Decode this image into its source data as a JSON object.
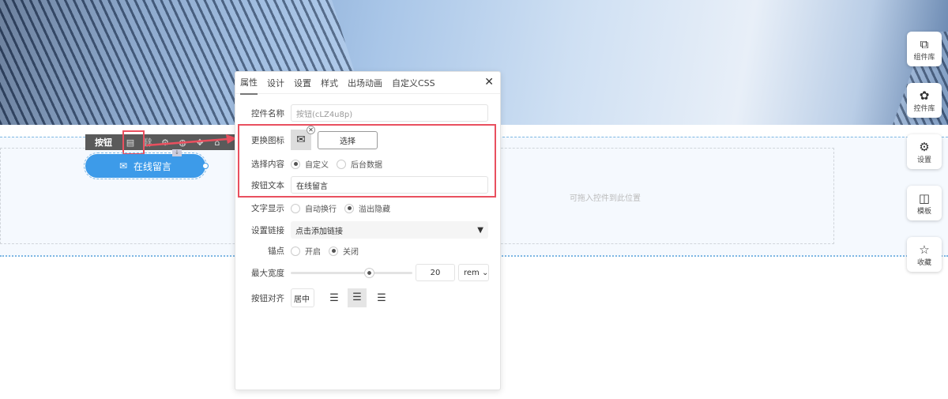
{
  "canvas": {
    "drop_hint": "可拖入控件到此位置"
  },
  "toolbar": {
    "label": "按钮",
    "icons": [
      "edit-icon",
      "link-icon",
      "gear-icon",
      "palette-icon",
      "move-icon",
      "delete-icon"
    ]
  },
  "button": {
    "label": "在线留言",
    "icon": "mail-icon"
  },
  "panel": {
    "tabs": [
      "属性",
      "设计",
      "设置",
      "样式",
      "出场动画",
      "自定义CSS"
    ],
    "name_label": "控件名称",
    "name_value": "按钮(cLZ4u8p)",
    "icon_label": "更换图标",
    "icon_select": "选择",
    "content_label": "选择内容",
    "content_options": [
      "自定义",
      "后台数据"
    ],
    "text_label": "按钮文本",
    "text_value": "在线留言",
    "display_label": "文字显示",
    "display_options": [
      "自动换行",
      "溢出隐藏"
    ],
    "link_label": "设置链接",
    "link_value": "点击添加链接",
    "anchor_label": "锚点",
    "anchor_options": [
      "开启",
      "关闭"
    ],
    "width_label": "最大宽度",
    "width_value": "20",
    "width_unit": "rem",
    "width_slider_percent": 65,
    "align_label": "按钮对齐",
    "align_value": "居中"
  },
  "sidebar": [
    {
      "label": "组件库"
    },
    {
      "label": "控件库"
    },
    {
      "label": "设置"
    },
    {
      "label": "模板"
    },
    {
      "label": "收藏"
    }
  ],
  "colors": {
    "accent": "#3d9be9",
    "highlight": "#e9505f"
  }
}
